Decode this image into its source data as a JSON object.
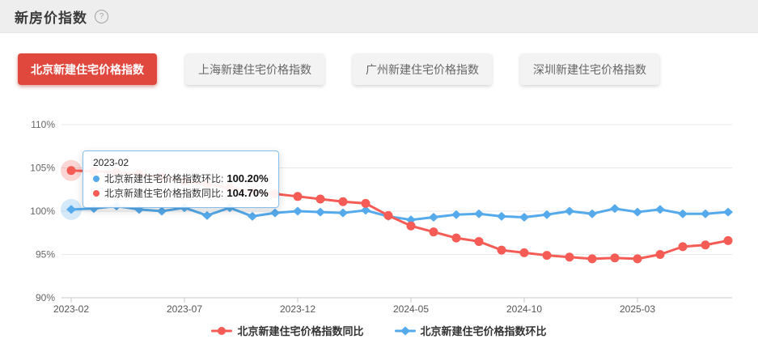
{
  "header": {
    "title": "新房价指数",
    "help_icon": "?"
  },
  "tabs": [
    {
      "label": "北京新建住宅价格指数",
      "active": true
    },
    {
      "label": "上海新建住宅价格指数",
      "active": false
    },
    {
      "label": "广州新建住宅价格指数",
      "active": false
    },
    {
      "label": "深圳新建住宅价格指数",
      "active": false
    }
  ],
  "colors": {
    "active_tab_red": "#e0483e",
    "line_red": "#f55c55",
    "line_blue": "#55aaeb",
    "header_bg": "#eeeeee"
  },
  "tooltip": {
    "date": "2023-02",
    "rows": [
      {
        "label": "北京新建住宅价格指数环比:",
        "value": "100.20%",
        "color": "#55aaeb"
      },
      {
        "label": "北京新建住宅价格指数同比:",
        "value": "104.70%",
        "color": "#f55c55"
      }
    ]
  },
  "legend": {
    "items": [
      {
        "label": "北京新建住宅价格指数同比",
        "color": "#f55c55",
        "marker": "circle"
      },
      {
        "label": "北京新建住宅价格指数环比",
        "color": "#55aaeb",
        "marker": "diamond"
      }
    ]
  },
  "chart_data": {
    "type": "line",
    "title": "新房价指数",
    "x": [
      "2023-02",
      "2023-03",
      "2023-04",
      "2023-05",
      "2023-06",
      "2023-07",
      "2023-08",
      "2023-09",
      "2023-10",
      "2023-11",
      "2023-12",
      "2024-01",
      "2024-02",
      "2024-03",
      "2024-04",
      "2024-05",
      "2024-06",
      "2024-07",
      "2024-08",
      "2024-09",
      "2024-10",
      "2024-11",
      "2024-12",
      "2025-01",
      "2025-02",
      "2025-03",
      "2025-04",
      "2025-05",
      "2025-06",
      "2025-07"
    ],
    "x_ticks": [
      "2023-02",
      "2023-07",
      "2023-12",
      "2024-05",
      "2024-10",
      "2025-03"
    ],
    "y_ticks": [
      {
        "label": "110%",
        "value": 110
      },
      {
        "label": "105%",
        "value": 105
      },
      {
        "label": "100%",
        "value": 100
      },
      {
        "label": "95%",
        "value": 95
      },
      {
        "label": "90%",
        "value": 90
      }
    ],
    "ylim": [
      90,
      110
    ],
    "grid": true,
    "legend_position": "bottom",
    "highlight_index": 0,
    "series": [
      {
        "name": "北京新建住宅价格指数同比",
        "color": "#f55c55",
        "marker": "circle",
        "values": [
          104.7,
          104.6,
          104.5,
          104.3,
          103.9,
          103.5,
          103.1,
          102.7,
          102.3,
          102.0,
          101.7,
          101.4,
          101.1,
          100.9,
          99.5,
          98.3,
          97.6,
          96.9,
          96.5,
          95.5,
          95.2,
          94.9,
          94.7,
          94.5,
          94.6,
          94.5,
          95.0,
          95.9,
          96.1,
          96.6
        ]
      },
      {
        "name": "北京新建住宅价格指数环比",
        "color": "#55aaeb",
        "marker": "diamond",
        "values": [
          100.2,
          100.3,
          100.6,
          100.2,
          100.0,
          100.4,
          99.5,
          100.4,
          99.4,
          99.8,
          100.0,
          99.9,
          99.8,
          100.1,
          99.4,
          99.0,
          99.3,
          99.6,
          99.7,
          99.4,
          99.3,
          99.6,
          100.0,
          99.7,
          100.3,
          99.9,
          100.2,
          99.7,
          99.7,
          99.9
        ]
      }
    ]
  }
}
